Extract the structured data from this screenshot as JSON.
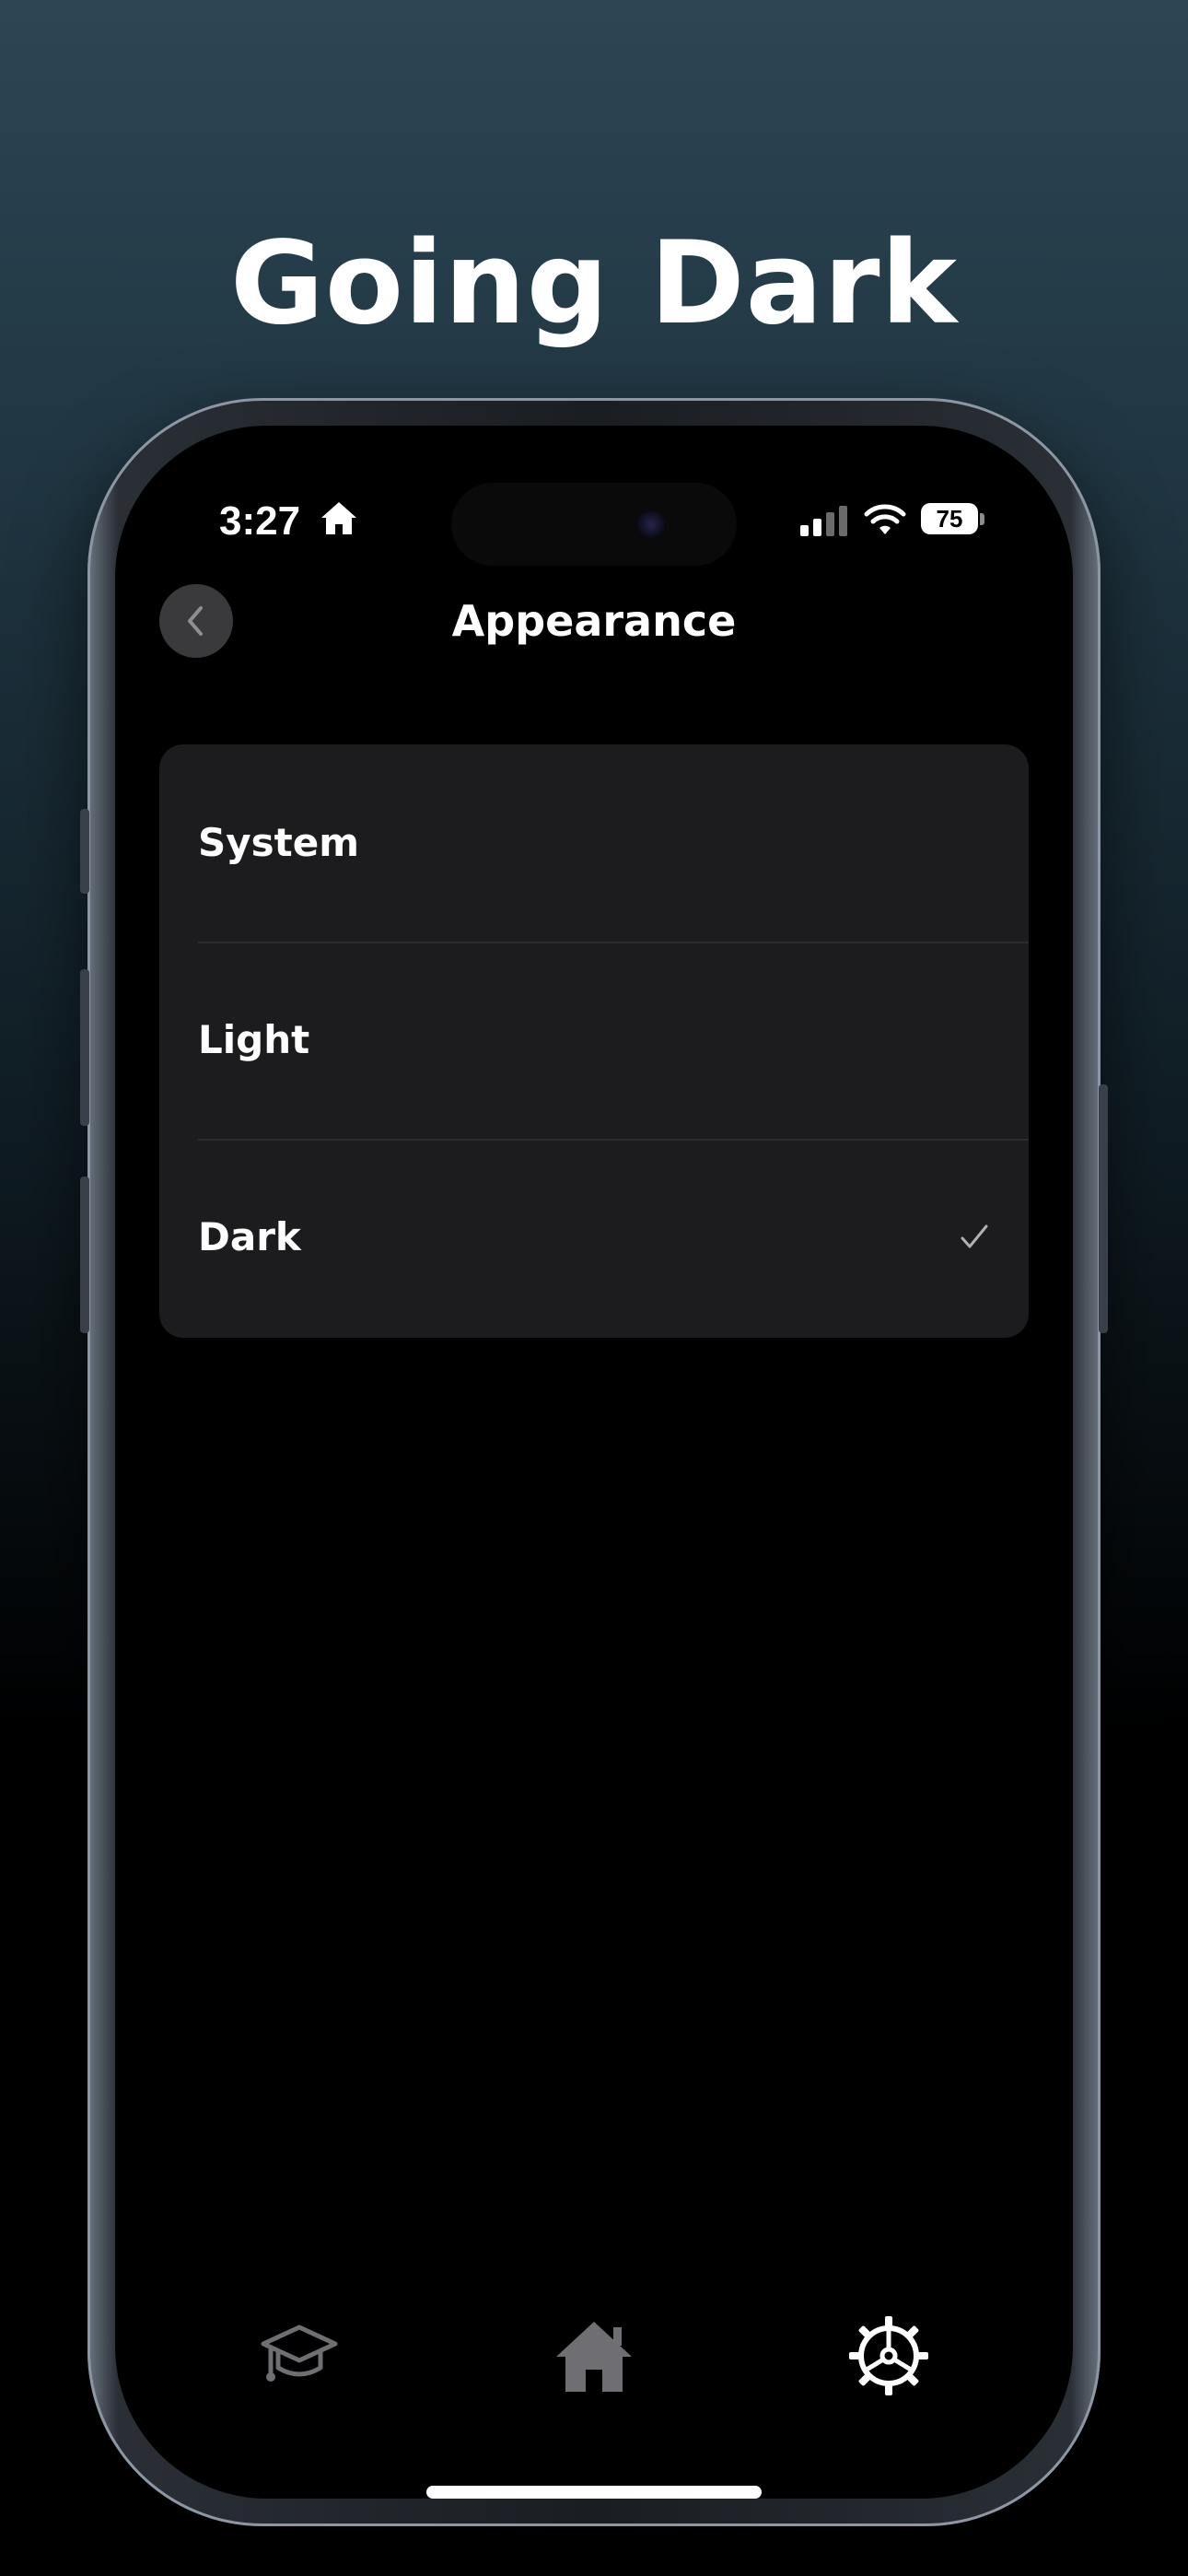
{
  "headline": "Going Dark",
  "status_bar": {
    "time": "3:27",
    "battery_level": "75",
    "icons": [
      "home-icon",
      "signal-icon",
      "wifi-icon",
      "battery-icon"
    ]
  },
  "nav": {
    "title": "Appearance",
    "back_icon": "chevron-left-icon"
  },
  "appearance_options": [
    {
      "label": "System",
      "selected": false
    },
    {
      "label": "Light",
      "selected": false
    },
    {
      "label": "Dark",
      "selected": true
    }
  ],
  "tab_bar": {
    "tabs": [
      {
        "icon": "graduation-cap-icon",
        "active": false
      },
      {
        "icon": "house-icon",
        "active": false
      },
      {
        "icon": "gear-icon",
        "active": true
      }
    ]
  },
  "colors": {
    "background_top": "#2c4654",
    "screen_background": "#000000",
    "card_background": "#1c1c1e",
    "active_tab": "#ffffff",
    "inactive_tab": "#6e6e73"
  }
}
